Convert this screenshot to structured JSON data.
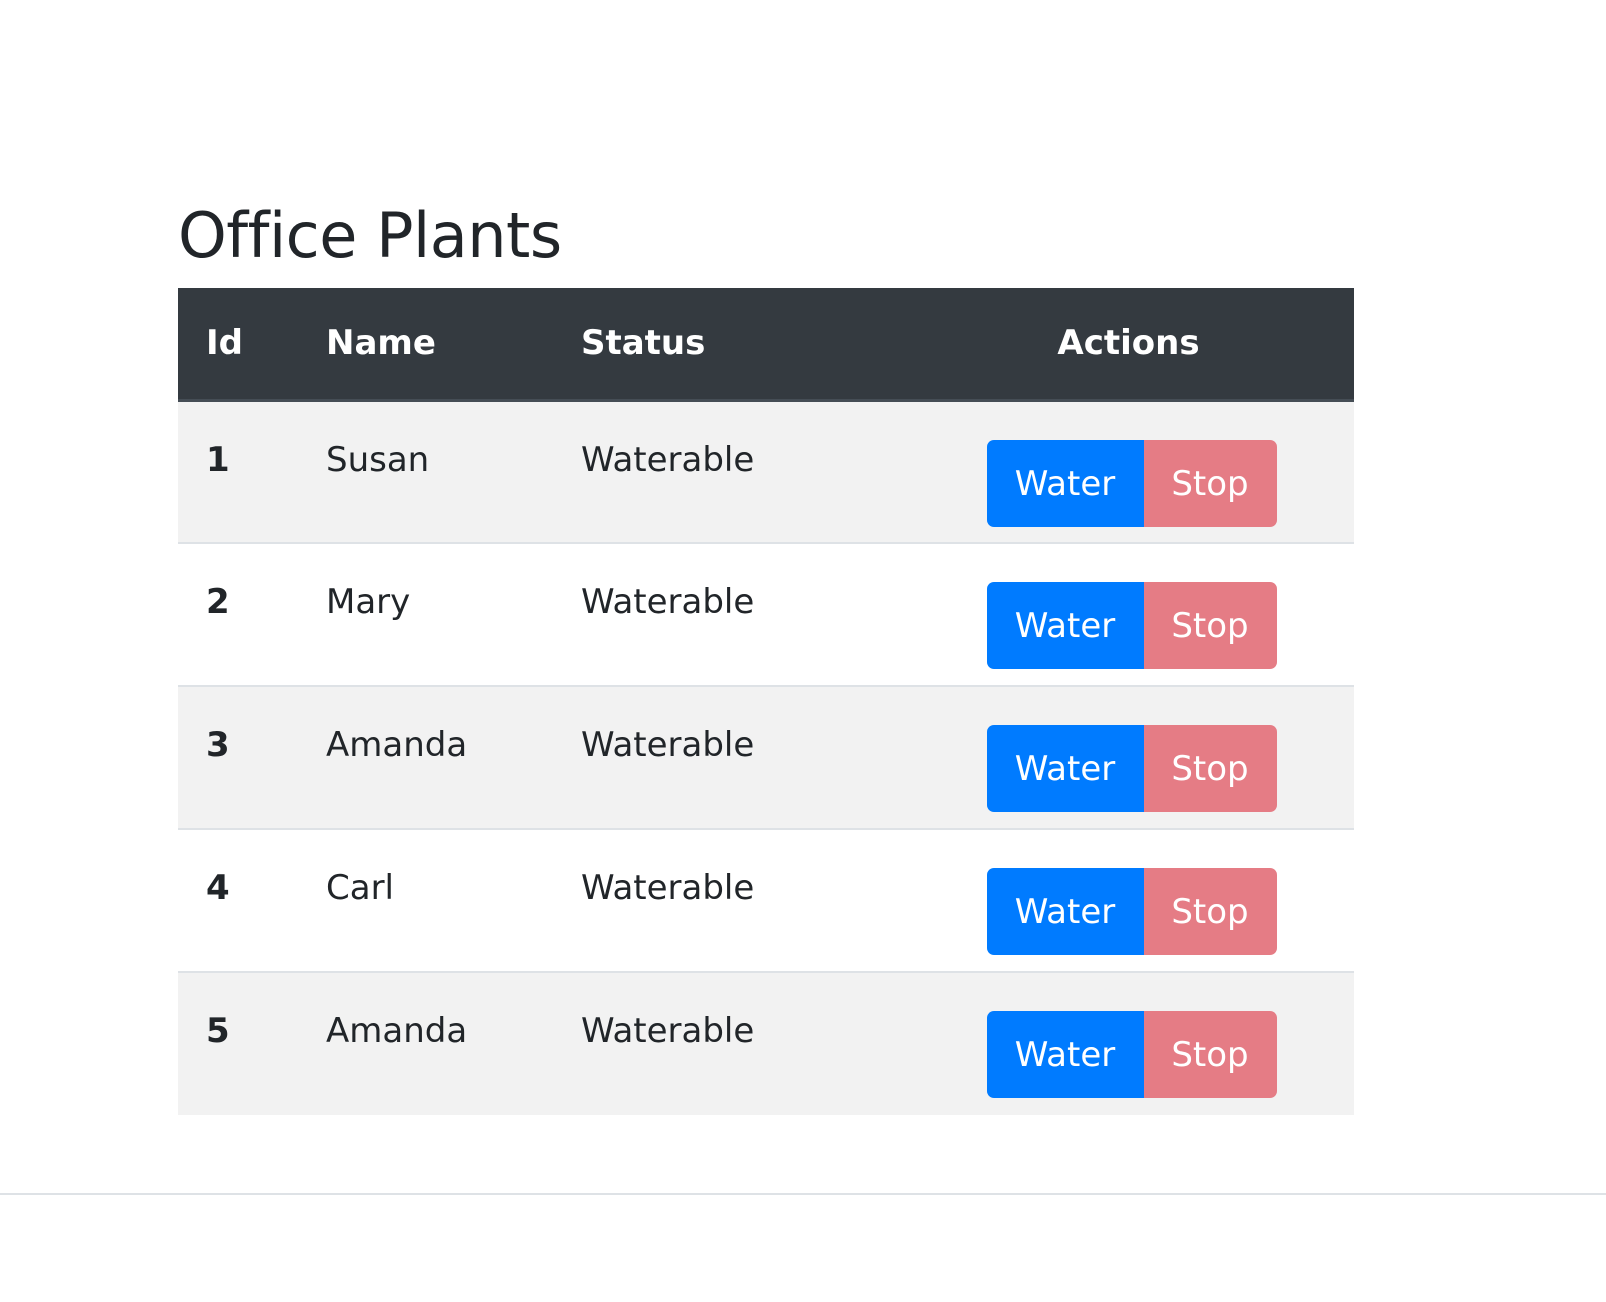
{
  "page": {
    "title": "Office Plants"
  },
  "table": {
    "headers": {
      "id": "Id",
      "name": "Name",
      "status": "Status",
      "actions": "Actions"
    },
    "rows": [
      {
        "id": "1",
        "name": "Susan",
        "status": "Waterable",
        "water_label": "Water",
        "stop_label": "Stop"
      },
      {
        "id": "2",
        "name": "Mary",
        "status": "Waterable",
        "water_label": "Water",
        "stop_label": "Stop"
      },
      {
        "id": "3",
        "name": "Amanda",
        "status": "Waterable",
        "water_label": "Water",
        "stop_label": "Stop"
      },
      {
        "id": "4",
        "name": "Carl",
        "status": "Waterable",
        "water_label": "Water",
        "stop_label": "Stop"
      },
      {
        "id": "5",
        "name": "Amanda",
        "status": "Waterable",
        "water_label": "Water",
        "stop_label": "Stop"
      }
    ]
  },
  "colors": {
    "header_background": "#343a40",
    "water_button": "#007bff",
    "stop_button": "#e57c85",
    "striped_row": "#f2f2f2"
  }
}
